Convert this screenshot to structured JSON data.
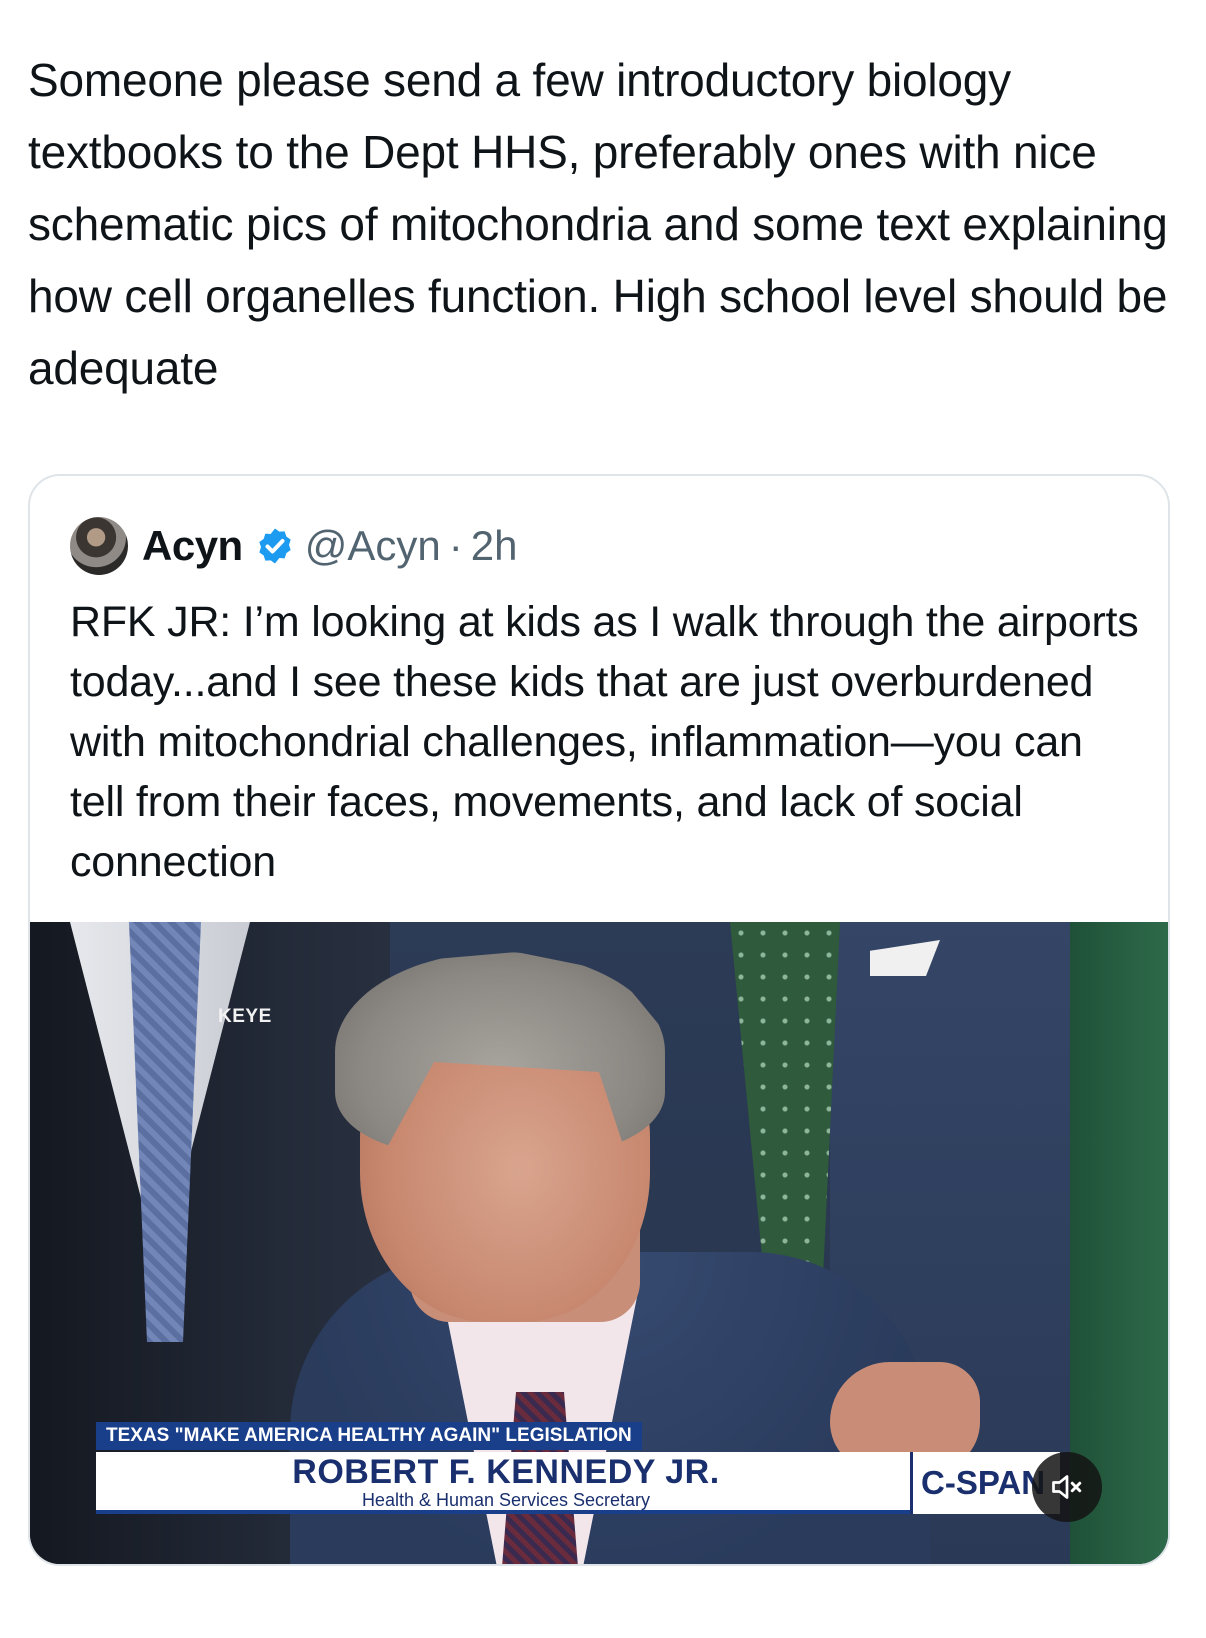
{
  "post": {
    "text": "Someone please send a few introductory biology textbooks to the Dept HHS, preferably ones with nice schematic pics of mitochondria and some text explaining how cell organelles function. High school level should be adequate"
  },
  "quoted": {
    "author_name": "Acyn",
    "handle": "@Acyn",
    "separator": "·",
    "time": "2h",
    "text": "RFK JR: I’m looking at kids as I walk through the airports today...and I see these kids that are just overburdened with mitochondrial challenges, inflammation—you can tell from their faces, movements, and lack of social connection",
    "media": {
      "station_bug": "KEYE",
      "chyron_strip": "TEXAS \"MAKE AMERICA HEALTHY AGAIN\" LEGISLATION",
      "chyron_name": "ROBERT F. KENNEDY JR.",
      "chyron_title": "Health & Human Services Secretary",
      "network": "C-SPAN",
      "muted": true
    }
  },
  "colors": {
    "verified_badge": "#1d9bf0",
    "chyron_blue": "#1a3f8a"
  }
}
